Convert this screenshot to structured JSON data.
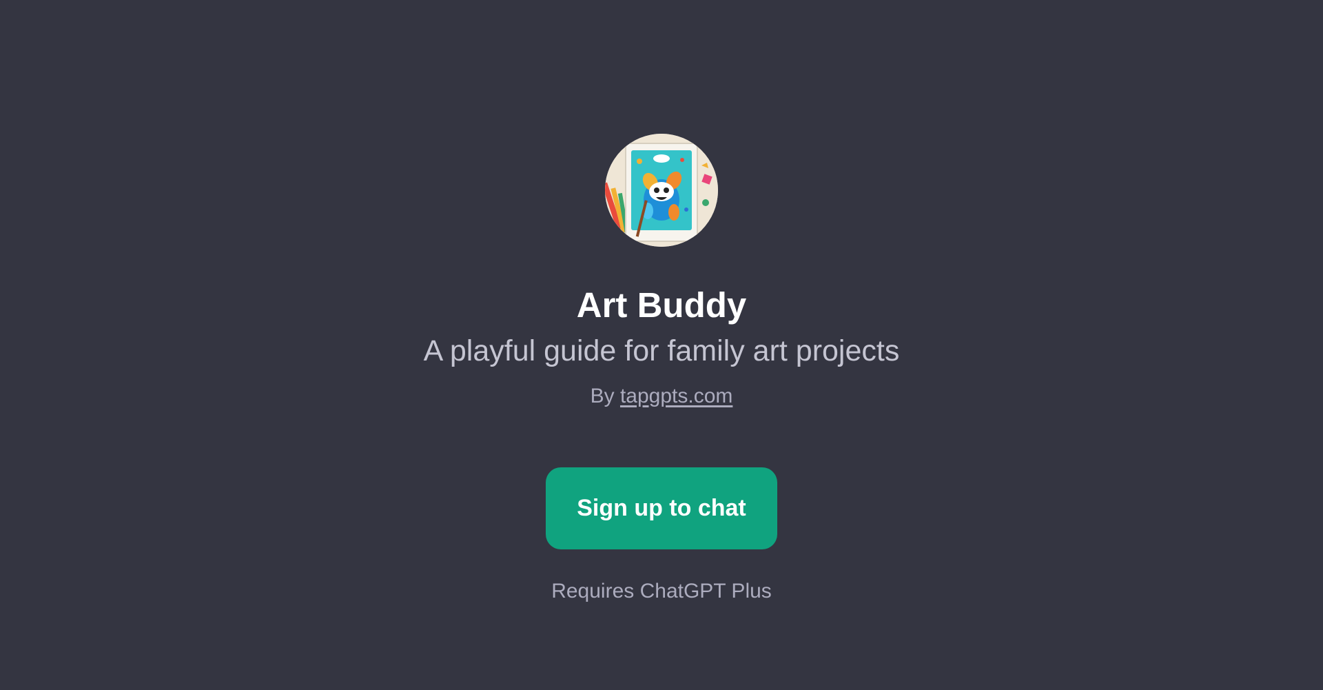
{
  "gpt": {
    "name": "Art Buddy",
    "description": "A playful guide for family art projects",
    "by_prefix": "By",
    "author": "tapgpts.com",
    "avatar_icon": "cartoon-art-character-icon"
  },
  "actions": {
    "signup_label": "Sign up to chat",
    "requirement": "Requires ChatGPT Plus"
  },
  "colors": {
    "background": "#343541",
    "accent": "#10a37f",
    "title": "#ffffff",
    "subtitle": "#c5c5d2",
    "muted": "#acacbe"
  }
}
